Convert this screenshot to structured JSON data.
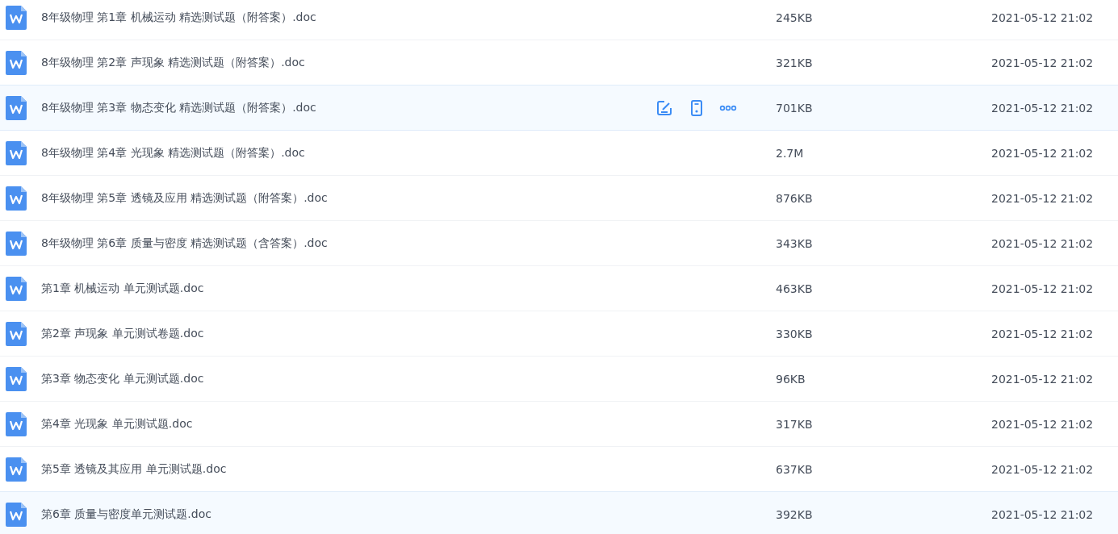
{
  "files": [
    {
      "name": "8年级物理 第1章 机械运动 精选测试题（附答案）.doc",
      "size": "245KB",
      "modified": "2021-05-12 21:02",
      "selected": false,
      "hovered": false
    },
    {
      "name": "8年级物理 第2章 声现象 精选测试题（附答案）.doc",
      "size": "321KB",
      "modified": "2021-05-12 21:02",
      "selected": false,
      "hovered": false
    },
    {
      "name": "8年级物理 第3章 物态变化 精选测试题（附答案）.doc",
      "size": "701KB",
      "modified": "2021-05-12 21:02",
      "selected": true,
      "hovered": true
    },
    {
      "name": "8年级物理 第4章 光现象 精选测试题（附答案）.doc",
      "size": "2.7M",
      "modified": "2021-05-12 21:02",
      "selected": false,
      "hovered": false
    },
    {
      "name": "8年级物理 第5章 透镜及应用 精选测试题（附答案）.doc",
      "size": "876KB",
      "modified": "2021-05-12 21:02",
      "selected": false,
      "hovered": false
    },
    {
      "name": "8年级物理 第6章 质量与密度 精选测试题（含答案）.doc",
      "size": "343KB",
      "modified": "2021-05-12 21:02",
      "selected": false,
      "hovered": false
    },
    {
      "name": "第1章 机械运动 单元测试题.doc",
      "size": "463KB",
      "modified": "2021-05-12 21:02",
      "selected": false,
      "hovered": false
    },
    {
      "name": "第2章 声现象 单元测试卷题.doc",
      "size": "330KB",
      "modified": "2021-05-12 21:02",
      "selected": false,
      "hovered": false
    },
    {
      "name": "第3章 物态变化 单元测试题.doc",
      "size": "96KB",
      "modified": "2021-05-12 21:02",
      "selected": false,
      "hovered": false
    },
    {
      "name": "第4章 光现象 单元测试题.doc",
      "size": "317KB",
      "modified": "2021-05-12 21:02",
      "selected": false,
      "hovered": false
    },
    {
      "name": "第5章 透镜及其应用 单元测试题.doc",
      "size": "637KB",
      "modified": "2021-05-12 21:02",
      "selected": false,
      "hovered": false
    },
    {
      "name": "第6章 质量与密度单元测试题.doc",
      "size": "392KB",
      "modified": "2021-05-12 21:02",
      "selected": true,
      "hovered": false
    }
  ]
}
